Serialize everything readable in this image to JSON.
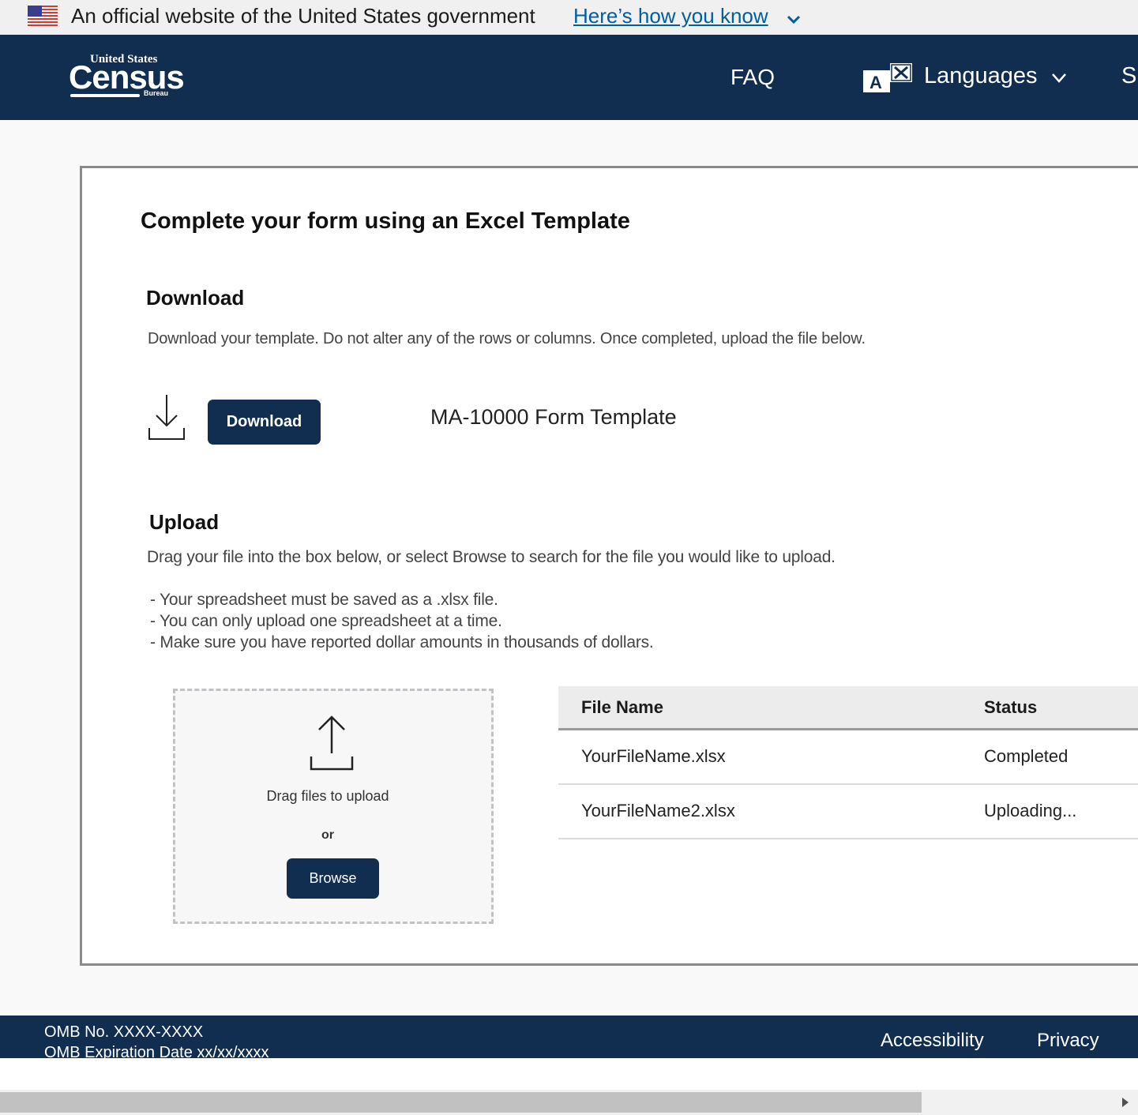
{
  "gov_banner": {
    "text": "An official website of the United States government",
    "link": "Here’s how you know"
  },
  "header": {
    "logo": {
      "top": "United States",
      "main": "Census",
      "sub": "Bureau"
    },
    "nav": {
      "faq": "FAQ",
      "languages": "Languages",
      "cut_item": "S"
    }
  },
  "main": {
    "title": "Complete your form using an Excel Template",
    "download": {
      "heading": "Download",
      "description": "Download your template. Do not alter any of the rows or columns. Once completed, upload the file below.",
      "button_label": "Download",
      "template_name": "MA-10000 Form Template"
    },
    "upload": {
      "heading": "Upload",
      "description": "Drag your file into the box below, or select Browse to search for the file you would like to upload.",
      "requirements": [
        "- Your spreadsheet must be saved as a .xlsx file.",
        "- You can only upload one spreadsheet at a time.",
        "- Make sure you have reported dollar amounts in thousands of dollars."
      ],
      "dropzone": {
        "text": "Drag files to upload",
        "or": "or",
        "browse_label": "Browse"
      },
      "table": {
        "headers": [
          "File Name",
          "Status"
        ],
        "rows": [
          {
            "file": "YourFileName.xlsx",
            "status": "Completed"
          },
          {
            "file": "YourFileName2.xlsx",
            "status": "Uploading..."
          }
        ]
      }
    }
  },
  "footer": {
    "omb_number": "OMB No. XXXX-XXXX",
    "omb_expiration": "OMB Expiration Date xx/xx/xxxx",
    "links": [
      "Accessibility",
      "Privacy"
    ]
  },
  "colors": {
    "navy": "#112e51",
    "link": "#005ea2",
    "banner_bg": "#f0f0f0"
  }
}
